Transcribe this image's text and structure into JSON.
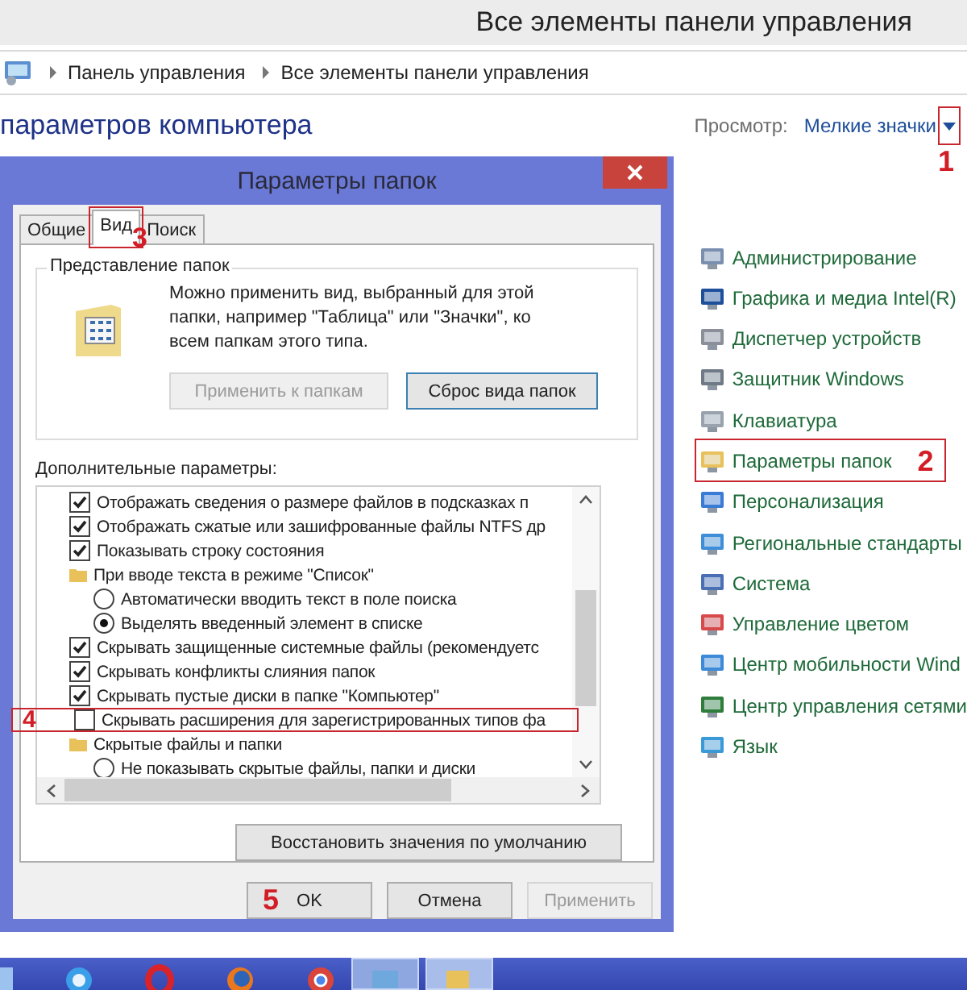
{
  "window": {
    "title": "Все элементы панели управления"
  },
  "address_bar": {
    "path": [
      "Панель управления",
      "Все элементы панели управления"
    ]
  },
  "header": {
    "heading": "параметров компьютера",
    "view_label": "Просмотр:",
    "view_value": "Мелкие значки",
    "marker": "1"
  },
  "items": [
    {
      "label": "Администрирование"
    },
    {
      "label": "Графика и медиа Intel(R)"
    },
    {
      "label": "Диспетчер устройств"
    },
    {
      "label": "Защитник Windows"
    },
    {
      "label": "Клавиатура"
    },
    {
      "label": "Параметры папок",
      "marker": "2"
    },
    {
      "label": "Персонализация"
    },
    {
      "label": "Региональные стандарты"
    },
    {
      "label": "Система"
    },
    {
      "label": "Управление цветом"
    },
    {
      "label": "Центр мобильности Wind"
    },
    {
      "label": "Центр управления сетями"
    },
    {
      "label": "Язык"
    }
  ],
  "dialog": {
    "title": "Параметры папок",
    "tabs": [
      {
        "label": "Общие",
        "selected": false
      },
      {
        "label": "Вид",
        "selected": true,
        "marker": "3"
      },
      {
        "label": "Поиск",
        "selected": false
      }
    ],
    "group": {
      "title": "Представление папок",
      "text": "Можно применить вид, выбранный для этой папки, например \"Таблица\" или \"Значки\", ко всем папкам этого типа.",
      "buttons": [
        {
          "label": "Применить к папкам",
          "disabled": true
        },
        {
          "label": "Сброс вида папок",
          "disabled": false
        }
      ]
    },
    "advanced_label": "Дополнительные параметры:",
    "options": [
      {
        "kind": "checkbox",
        "label": "Отображать сведения о размере файлов в подсказках п",
        "checked": true
      },
      {
        "kind": "checkbox",
        "label": "Отображать сжатые или зашифрованные файлы NTFS др",
        "checked": true
      },
      {
        "kind": "checkbox",
        "label": "Показывать строку состояния",
        "checked": true
      },
      {
        "kind": "folder",
        "label": "При вводе текста в режиме \"Список\""
      },
      {
        "kind": "radio",
        "label": "Автоматически вводить текст в поле поиска",
        "checked": false
      },
      {
        "kind": "radio",
        "label": "Выделять введенный элемент в списке",
        "checked": true
      },
      {
        "kind": "checkbox",
        "label": "Скрывать защищенные системные файлы (рекомендуетс",
        "checked": true
      },
      {
        "kind": "checkbox",
        "label": "Скрывать конфликты слияния папок",
        "checked": true
      },
      {
        "kind": "checkbox",
        "label": "Скрывать пустые диски в папке \"Компьютер\"",
        "checked": true
      },
      {
        "kind": "checkbox",
        "label": "Скрывать расширения для зарегистрированных типов фа",
        "checked": false,
        "marker": "4"
      },
      {
        "kind": "folder",
        "label": "Скрытые файлы и папки"
      },
      {
        "kind": "radio",
        "label": "Не показывать скрытые файлы, папки и диски",
        "checked": false
      }
    ],
    "restore_button": "Восстановить значения по умолчанию",
    "buttons": [
      {
        "label": "OK",
        "disabled": false,
        "marker": "5"
      },
      {
        "label": "Отмена",
        "disabled": false
      },
      {
        "label": "Применить",
        "disabled": true
      }
    ]
  }
}
